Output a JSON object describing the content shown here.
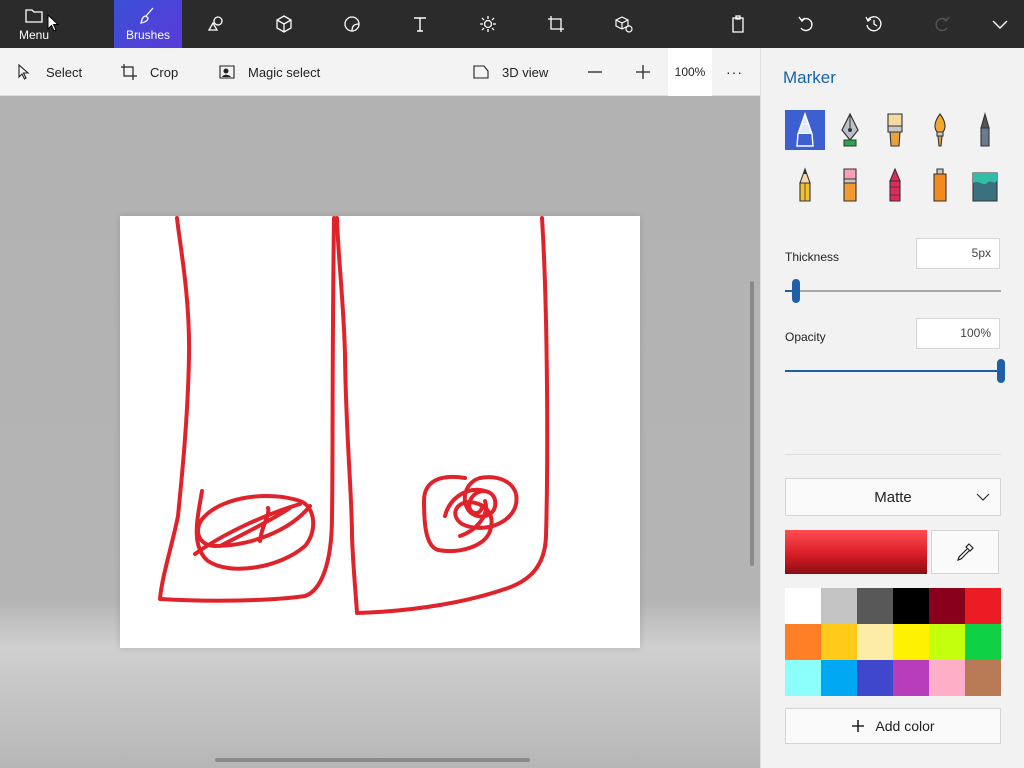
{
  "topbar": {
    "menu_label": "Menu",
    "brushes_label": "Brushes",
    "tools": [
      "brushes-icon",
      "2d-shapes-icon",
      "3d-shapes-icon",
      "stickers-icon",
      "text-icon",
      "effects-icon",
      "canvas-icon",
      "3d-library-icon",
      "paste-icon",
      "undo-icon",
      "history-icon",
      "redo-icon",
      "chevron-down-icon"
    ]
  },
  "subbar": {
    "select_label": "Select",
    "crop_label": "Crop",
    "magic_select_label": "Magic select",
    "view3d_label": "3D view",
    "zoom_value": "100%",
    "more_label": "···"
  },
  "panel": {
    "title": "Marker",
    "brushes": [
      "marker",
      "calligraphy-pen",
      "oil-brush",
      "watercolor",
      "pixel-pen",
      "pencil",
      "eraser",
      "crayon",
      "spray-can",
      "fill"
    ],
    "thickness_label": "Thickness",
    "thickness_value": "5px",
    "thickness_level": 0.05,
    "opacity_label": "Opacity",
    "opacity_value": "100%",
    "opacity_level": 1.0,
    "finish_value": "Matte",
    "current_color": "#e0232b",
    "add_color_label": "Add color",
    "palette": [
      "#ffffff",
      "#c3c3c3",
      "#585858",
      "#000000",
      "#88001b",
      "#ec1c24",
      "#ff7f27",
      "#ffca18",
      "#fdeca6",
      "#fff200",
      "#c4ff0e",
      "#0ed145",
      "#8cfffb",
      "#00a8f3",
      "#3f48cc",
      "#b83dba",
      "#ffaec8",
      "#b97a56"
    ]
  },
  "canvas": {
    "stroke_color": "#e0232b"
  }
}
